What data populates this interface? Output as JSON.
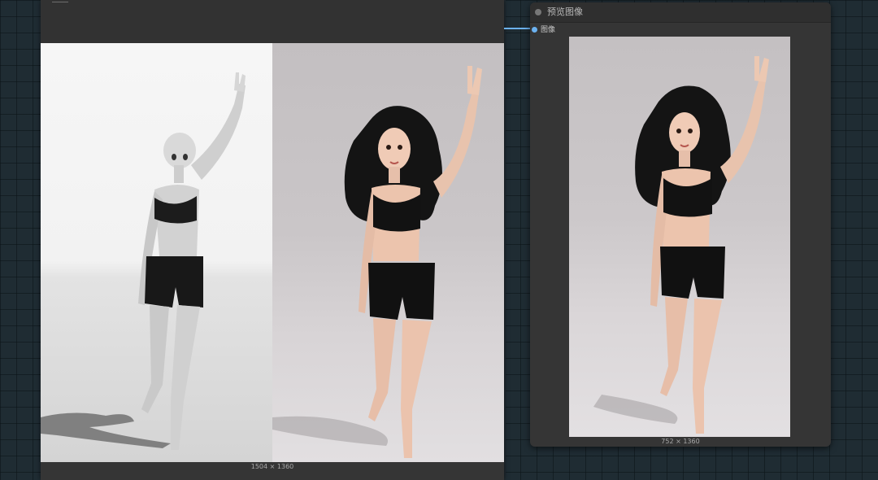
{
  "left_node": {
    "image_dims": "1504 × 1360"
  },
  "right_node": {
    "title": "预览图像",
    "input_label": "图像",
    "image_dims": "752 × 1360"
  },
  "colors": {
    "canvas_bg": "#1f2c33",
    "node_bg": "#353535",
    "wire": "#6cb2f0"
  }
}
